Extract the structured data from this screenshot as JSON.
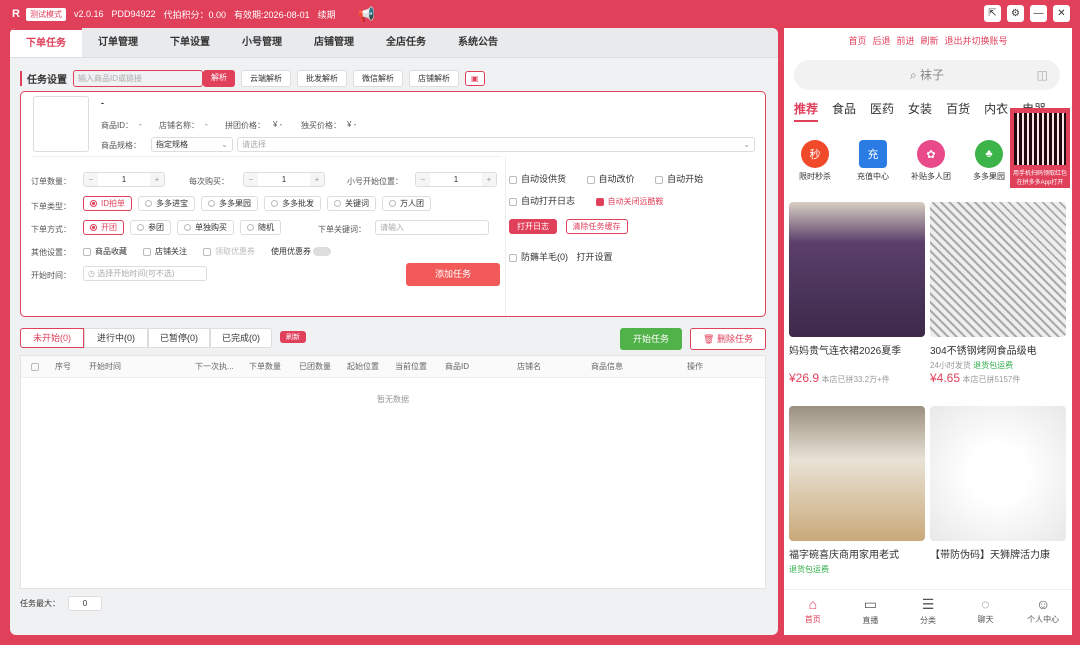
{
  "titlebar": {
    "logo": "R",
    "mode_badge": "测试模式",
    "version": "v2.0.16",
    "account": "PDD94922",
    "points": "代拍积分：0.00",
    "expiry": "有效期:2026-08-01",
    "renew": "续期"
  },
  "tabs": [
    "下单任务",
    "订单管理",
    "下单设置",
    "小号管理",
    "店铺管理",
    "全店任务",
    "系统公告"
  ],
  "task_settings": {
    "title": "任务设置",
    "input_placeholder": "输入商品ID或链接",
    "parse": "解析",
    "cloud_parse": "云端解析",
    "batch_parse": "批发解析",
    "wechat_parse": "微信解析",
    "shop_parse": "店铺解析"
  },
  "product": {
    "dash": "-",
    "id_label": "商品ID：",
    "id_val": "-",
    "shop_label": "店铺名称：",
    "shop_val": "-",
    "group_label": "拼团价格：",
    "group_val": "¥ -",
    "single_label": "独买价格：",
    "single_val": "¥ -",
    "spec_label": "商品规格：",
    "spec_select": "指定规格",
    "spec_placeholder": "请选择"
  },
  "form": {
    "order_qty_label": "订单数量：",
    "order_qty": "1",
    "per_buy_label": "每次购买：",
    "per_buy": "1",
    "start_pos_label": "小号开始位置：",
    "start_pos": "1",
    "type_label": "下单类型：",
    "types": [
      "ID拍单",
      "多多进宝",
      "多多果园",
      "多多批发",
      "关键词",
      "万人团"
    ],
    "method_label": "下单方式：",
    "methods": [
      "开团",
      "参团",
      "单独购买",
      "随机"
    ],
    "keyword_label": "下单关键词：",
    "keyword_placeholder": "请输入",
    "other_label": "其他设置：",
    "others": [
      "商品收藏",
      "店铺关注",
      "领取优惠券",
      "使用优惠券"
    ],
    "start_time_label": "开始时间：",
    "start_time_placeholder": "选择开始时间(可不选)",
    "add_task": "添加任务"
  },
  "right_opts": {
    "auto_address": "自动设供货",
    "auto_price": "自动改价",
    "auto_start": "自动开始",
    "auto_log": "自动打开日志",
    "auto_close": "自动关闭远酷鞍",
    "open_log": "打开日志",
    "clear_cache": "清除任务缓存",
    "anti": "防薅羊毛(0)",
    "open_settings": "打开设置"
  },
  "status_tabs": [
    "未开始(0)",
    "进行中(0)",
    "已暂停(0)",
    "已完成(0)"
  ],
  "refresh": "刷新",
  "start_task": "开始任务",
  "delete_task": "删除任务",
  "table": {
    "headers": [
      "序号",
      "开始时间",
      "下一次执...",
      "下单数量",
      "已团数量",
      "起始位置",
      "当前位置",
      "商品ID",
      "店铺名",
      "商品信息",
      "操作"
    ],
    "empty": "暂无数据"
  },
  "footer": {
    "label": "任务最大：",
    "value": "0"
  },
  "browser": {
    "links": [
      "首页",
      "后退",
      "前进",
      "刷新",
      "退出并切换账号"
    ],
    "search": "袜子",
    "categories": [
      "推荐",
      "食品",
      "医药",
      "女装",
      "百货",
      "内衣",
      "电器"
    ],
    "qr_text": "用手机扫码领取红包 在拼多多App打开",
    "icons": [
      {
        "label": "限时秒杀",
        "color": "#f04a2a",
        "glyph": "秒"
      },
      {
        "label": "充值中心",
        "color": "#2a7be4",
        "glyph": "充"
      },
      {
        "label": "补贴多人团",
        "color": "#e84a8a",
        "glyph": "✿"
      },
      {
        "label": "多多果园",
        "color": "#3cb44a",
        "glyph": "♣"
      }
    ],
    "products": [
      {
        "title": "妈妈贵气连衣裙2026夏季",
        "sub": "",
        "price": "¥26.9",
        "sold": "本店已拼33.2万+件",
        "img": "#5a3f6a"
      },
      {
        "title": "304不锈钢烤网食品级电",
        "sub": "24小时发货",
        "tag": "退货包运费",
        "price": "¥4.65",
        "sold": "本店已拼5157件",
        "img": "#b9b9b9"
      },
      {
        "title": "福字碗喜庆商用家用老式",
        "sub": "",
        "tag": "退货包运费",
        "price": "",
        "sold": "",
        "img": "#c9a97a"
      },
      {
        "title": "【带防伪码】天狮牌活力康",
        "sub": "",
        "tag": "",
        "price": "",
        "sold": "",
        "img": "#eeeeee"
      }
    ],
    "bottom_nav": [
      "首页",
      "直播",
      "分类",
      "聊天",
      "个人中心"
    ]
  }
}
